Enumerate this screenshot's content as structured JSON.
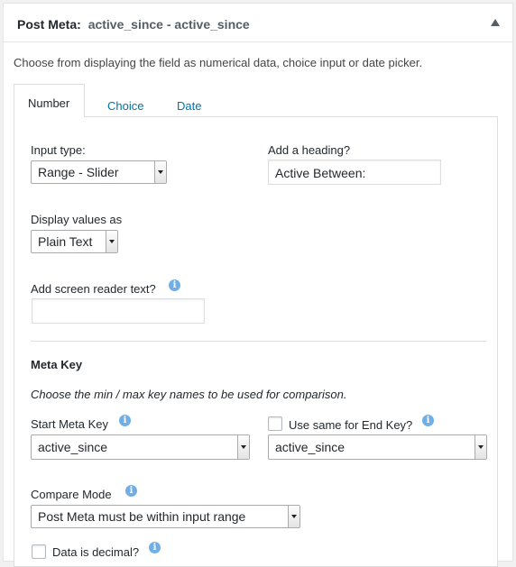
{
  "header": {
    "label": "Post Meta:",
    "value": "active_since - active_since"
  },
  "intro": "Choose from displaying the field as numerical data, choice input or date picker.",
  "tabs": [
    {
      "label": "Number",
      "active": true
    },
    {
      "label": "Choice",
      "active": false
    },
    {
      "label": "Date",
      "active": false
    }
  ],
  "form": {
    "input_type_label": "Input type:",
    "input_type_value": "Range - Slider",
    "heading_label": "Add a heading?",
    "heading_value": "Active Between:",
    "display_values_label": "Display values as",
    "display_values_value": "Plain Text",
    "screen_reader_label": "Add screen reader text?",
    "screen_reader_value": "",
    "meta_key_heading": "Meta Key",
    "meta_key_desc": "Choose the min / max key names to be used for comparison.",
    "start_meta_key_label": "Start Meta Key",
    "start_meta_key_value": "active_since",
    "use_same_label": "Use same for End Key?",
    "use_same_checked": false,
    "end_meta_key_value": "active_since",
    "compare_mode_label": "Compare Mode",
    "compare_mode_value": "Post Meta must be within input range",
    "data_is_decimal_label": "Data is decimal?",
    "data_is_decimal_checked": false
  },
  "icons": {
    "info": "info-icon",
    "collapse": "triangle-up-icon"
  },
  "colors": {
    "link": "#0073aa",
    "info": "#72aee6"
  }
}
